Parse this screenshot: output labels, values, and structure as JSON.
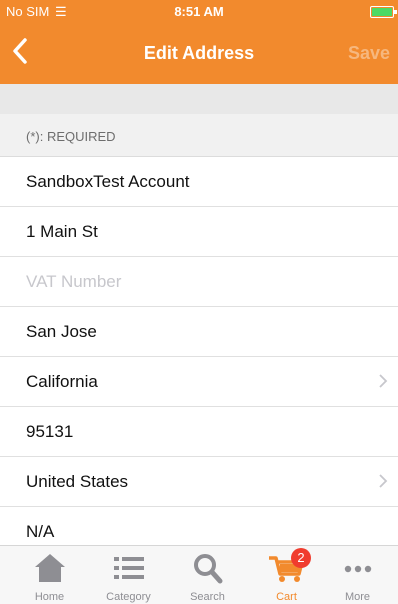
{
  "status_bar": {
    "carrier": "No SIM",
    "time": "8:51 AM"
  },
  "nav": {
    "title": "Edit Address",
    "save_label": "Save"
  },
  "form": {
    "required_note": "(*): REQUIRED",
    "name": "SandboxTest Account",
    "street": "1 Main St",
    "vat_placeholder": "VAT Number",
    "city": "San Jose",
    "state": "California",
    "zip": "95131",
    "country": "United States",
    "phone": "N/A"
  },
  "tabbar": {
    "tabs": [
      {
        "label": "Home",
        "icon": "home-icon"
      },
      {
        "label": "Category",
        "icon": "list-icon"
      },
      {
        "label": "Search",
        "icon": "search-icon"
      },
      {
        "label": "Cart",
        "icon": "cart-icon",
        "badge": "2",
        "active": true
      },
      {
        "label": "More",
        "icon": "more-icon"
      }
    ]
  },
  "colors": {
    "accent": "#f28a2d",
    "badge": "#f03c2e",
    "save_disabled": "#f6b77e"
  }
}
